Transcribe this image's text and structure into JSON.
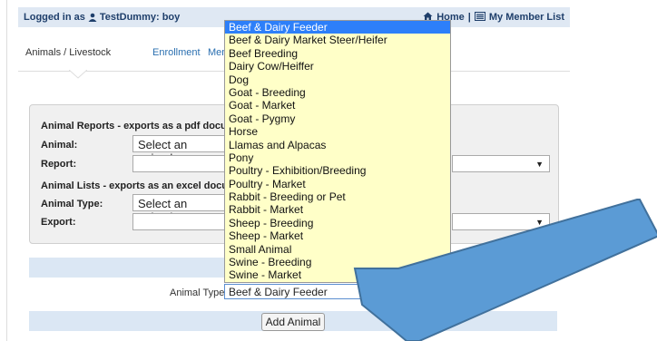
{
  "topbar": {
    "logged_in_prefix": "Logged in as",
    "user": "TestDummy: boy",
    "home": "Home",
    "separator": "|",
    "my_member_list": "My Member List"
  },
  "tabs": [
    "Animals / Livestock",
    "Enrollment",
    "Member"
  ],
  "reports": {
    "section1": "Animal Reports - exports as a pdf documen",
    "animal_label": "Animal:",
    "animal_placeholder": "Select an animal ...",
    "report_label": "Report:",
    "section2": "Animal Lists - exports as an excel documen",
    "animal_type_label": "Animal Type:",
    "animal_type_placeholder": "Select an animal ty",
    "export_label": "Export:"
  },
  "add": {
    "animal_type_label": "Animal Type:",
    "selected": "Beef & Dairy Feeder",
    "button": "Add Animal"
  },
  "dropdown": {
    "selected_index": 0,
    "options": [
      "Beef & Dairy Feeder",
      "Beef & Dairy Market Steer/Heifer",
      "Beef Breeding",
      "Dairy Cow/Heiffer",
      "Dog",
      "Goat - Breeding",
      "Goat - Market",
      "Goat - Pygmy",
      "Horse",
      "Llamas and Alpacas",
      "Pony",
      "Poultry - Exhibition/Breeding",
      "Poultry - Market",
      "Rabbit - Breeding or Pet",
      "Rabbit - Market",
      "Sheep - Breeding",
      "Sheep - Market",
      "Small Animal",
      "Swine - Breeding",
      "Swine - Market"
    ]
  },
  "colors": {
    "arrow": "#5b9bd5",
    "arrow_stroke": "#41719c",
    "selected": "#2d7ff9",
    "dropdown_bg": "#ffffc8"
  }
}
